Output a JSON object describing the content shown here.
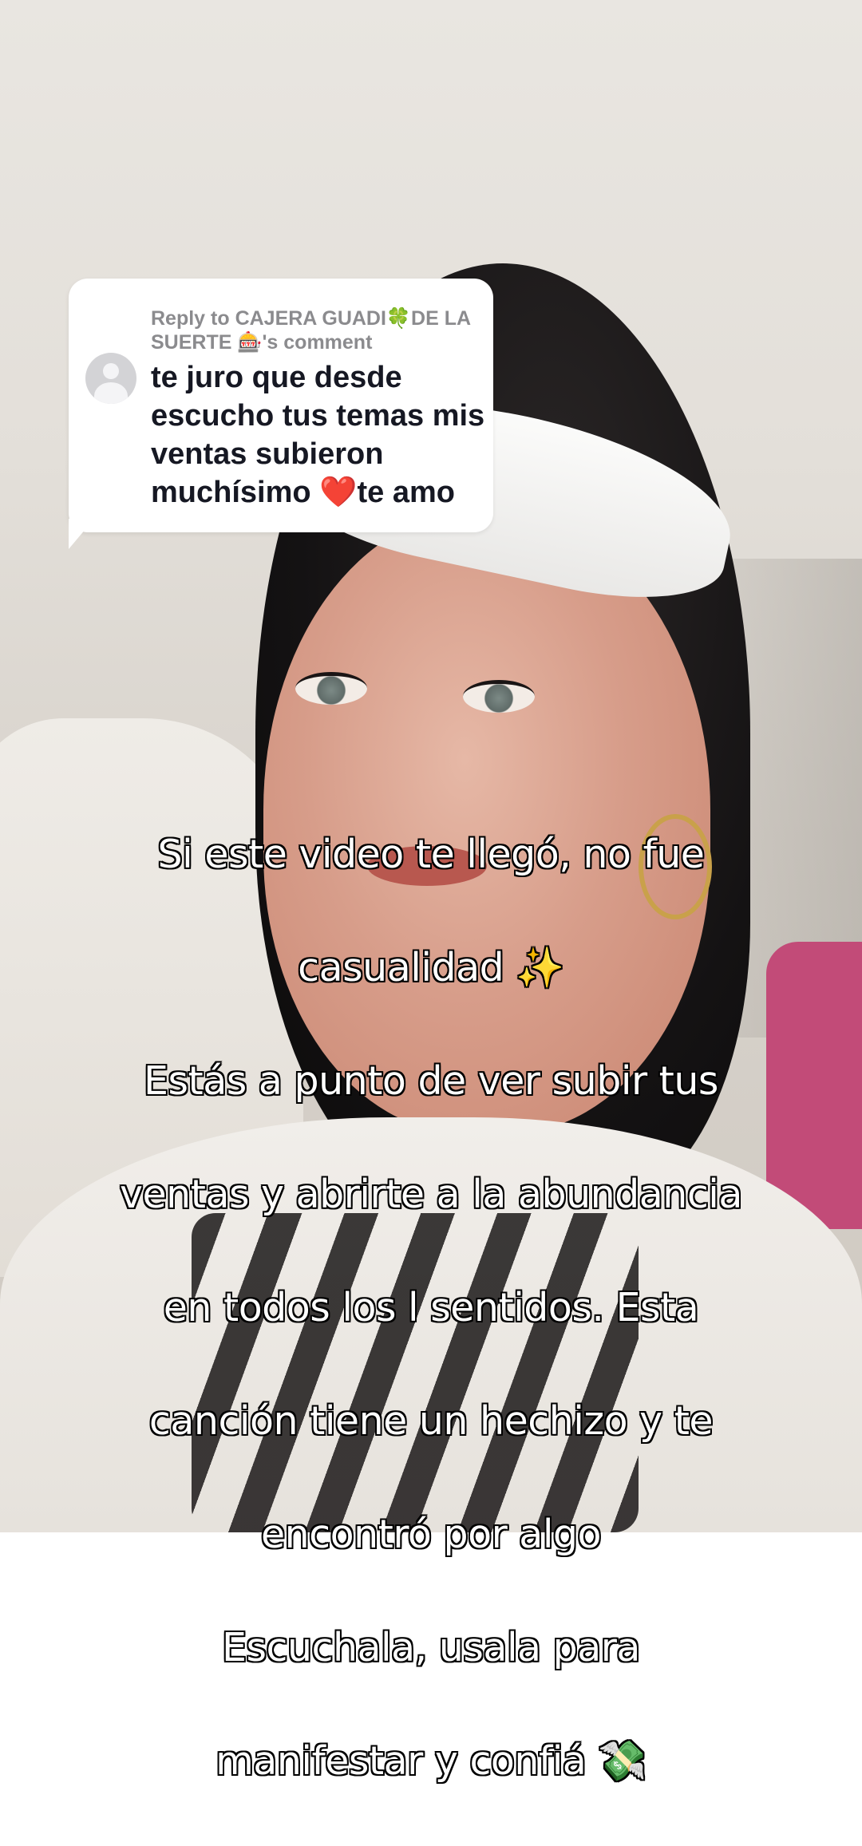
{
  "reply_sticker": {
    "header": "Reply to CAJERA GUADI🍀DE LA SUERTE 🎰's comment",
    "comment": "te juro que desde escucho tus temas mis ventas subieron muchísimo ❤️te amo"
  },
  "caption": {
    "lines": [
      "Si este video te llegó, no fue",
      "casualidad ✨",
      "Estás a punto de ver subir tus",
      "ventas y abrirte a la abundancia",
      "en todos los l sentidos. Esta",
      "canción tiene un hechizo y te",
      "encontró por algo",
      "Escuchala, usala para",
      "manifestar y confiá 💸"
    ]
  },
  "icons": {
    "avatar": "default-user-avatar-icon"
  }
}
